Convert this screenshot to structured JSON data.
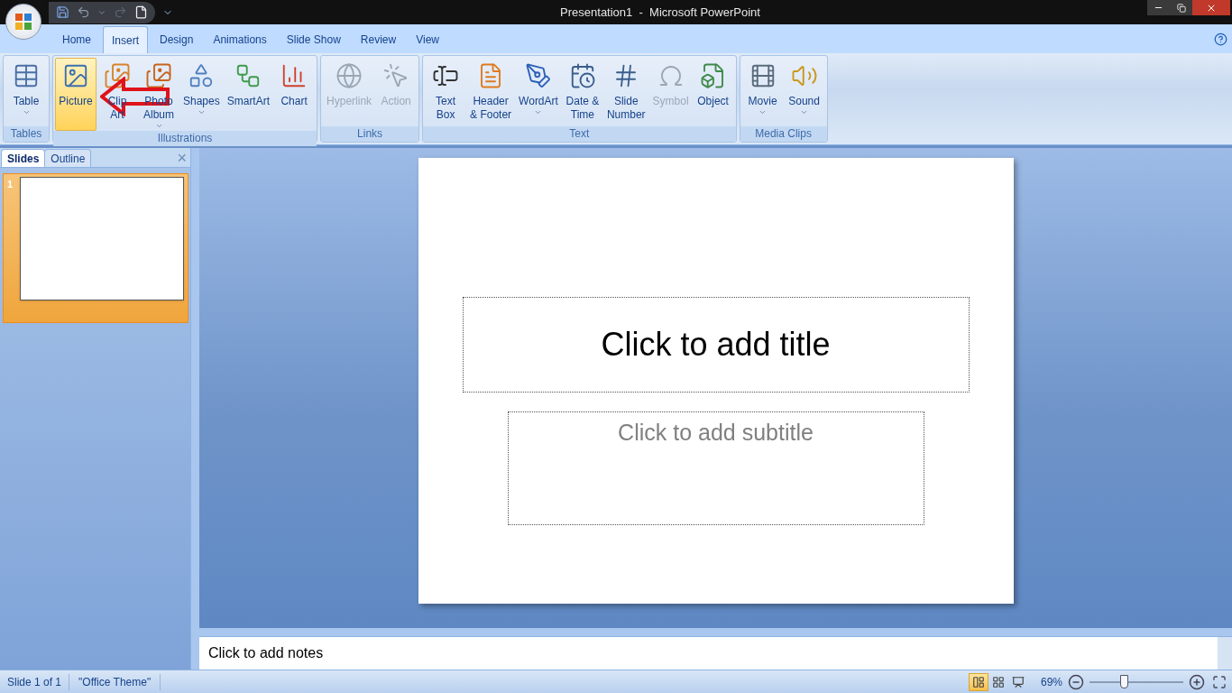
{
  "window": {
    "title": "Presentation1  -  Microsoft PowerPoint"
  },
  "tabs": [
    {
      "label": "Home",
      "selected": false
    },
    {
      "label": "Insert",
      "selected": true
    },
    {
      "label": "Design",
      "selected": false
    },
    {
      "label": "Animations",
      "selected": false
    },
    {
      "label": "Slide Show",
      "selected": false
    },
    {
      "label": "Review",
      "selected": false
    },
    {
      "label": "View",
      "selected": false
    }
  ],
  "ribbon_groups": [
    {
      "label": "Tables",
      "buttons": [
        {
          "label": "Table",
          "selected": false,
          "disabled": false,
          "dropdown": true
        }
      ]
    },
    {
      "label": "Illustrations",
      "buttons": [
        {
          "label": "Picture",
          "selected": true,
          "disabled": false,
          "dropdown": false
        },
        {
          "label": "Clip\nArt",
          "selected": false,
          "disabled": false,
          "dropdown": false
        },
        {
          "label": "Photo\nAlbum",
          "selected": false,
          "disabled": false,
          "dropdown": true
        },
        {
          "label": "Shapes",
          "selected": false,
          "disabled": false,
          "dropdown": true
        },
        {
          "label": "SmartArt",
          "selected": false,
          "disabled": false,
          "dropdown": false
        },
        {
          "label": "Chart",
          "selected": false,
          "disabled": false,
          "dropdown": false
        }
      ]
    },
    {
      "label": "Links",
      "buttons": [
        {
          "label": "Hyperlink",
          "selected": false,
          "disabled": true,
          "dropdown": false
        },
        {
          "label": "Action",
          "selected": false,
          "disabled": true,
          "dropdown": false
        }
      ]
    },
    {
      "label": "Text",
      "buttons": [
        {
          "label": "Text\nBox",
          "selected": false,
          "disabled": false,
          "dropdown": false
        },
        {
          "label": "Header\n& Footer",
          "selected": false,
          "disabled": false,
          "dropdown": false
        },
        {
          "label": "WordArt",
          "selected": false,
          "disabled": false,
          "dropdown": true
        },
        {
          "label": "Date &\nTime",
          "selected": false,
          "disabled": false,
          "dropdown": false
        },
        {
          "label": "Slide\nNumber",
          "selected": false,
          "disabled": false,
          "dropdown": false
        },
        {
          "label": "Symbol",
          "selected": false,
          "disabled": true,
          "dropdown": false
        },
        {
          "label": "Object",
          "selected": false,
          "disabled": false,
          "dropdown": false
        }
      ]
    },
    {
      "label": "Media Clips",
      "buttons": [
        {
          "label": "Movie",
          "selected": false,
          "disabled": false,
          "dropdown": true
        },
        {
          "label": "Sound",
          "selected": false,
          "disabled": false,
          "dropdown": true
        }
      ]
    }
  ],
  "panel": {
    "tabs": [
      {
        "label": "Slides",
        "selected": true
      },
      {
        "label": "Outline",
        "selected": false
      }
    ],
    "close": "×",
    "thumbnails": [
      {
        "number": "1",
        "selected": true
      }
    ]
  },
  "slide": {
    "title_placeholder": "Click to add title",
    "subtitle_placeholder": "Click to add subtitle"
  },
  "notes": {
    "placeholder": "Click to add notes"
  },
  "status_bar": {
    "slide": "Slide 1 of 1",
    "theme": "\"Office Theme\"",
    "views": [
      {
        "selected": true
      },
      {
        "selected": false
      },
      {
        "selected": false
      }
    ],
    "zoom": "69%",
    "zoom_slider": {
      "level": 0.37
    }
  }
}
